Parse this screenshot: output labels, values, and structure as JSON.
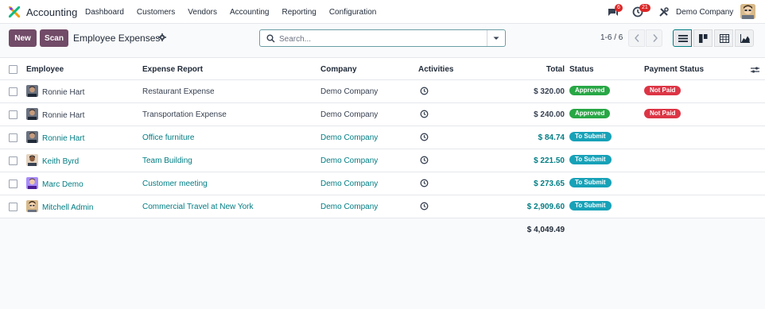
{
  "app": {
    "name": "Accounting"
  },
  "nav": {
    "items": [
      "Dashboard",
      "Customers",
      "Vendors",
      "Accounting",
      "Reporting",
      "Configuration"
    ]
  },
  "systray": {
    "messages_count": "6",
    "activities_count": "21",
    "company": "Demo Company"
  },
  "control": {
    "new_label": "New",
    "scan_label": "Scan",
    "title": "Employee Expenses",
    "search_placeholder": "Search...",
    "pager": "1-6 / 6"
  },
  "columns": {
    "employee": "Employee",
    "expense_report": "Expense Report",
    "company": "Company",
    "activities": "Activities",
    "total": "Total",
    "status": "Status",
    "payment_status": "Payment Status"
  },
  "rows": [
    {
      "employee": "Ronnie Hart",
      "report": "Restaurant Expense",
      "company": "Demo Company",
      "total": "$ 320.00",
      "status": "Approved",
      "payment": "Not Paid",
      "link": false
    },
    {
      "employee": "Ronnie Hart",
      "report": "Transportation Expense",
      "company": "Demo Company",
      "total": "$ 240.00",
      "status": "Approved",
      "payment": "Not Paid",
      "link": false
    },
    {
      "employee": "Ronnie Hart",
      "report": "Office furniture",
      "company": "Demo Company",
      "total": "$ 84.74",
      "status": "To Submit",
      "payment": "",
      "link": true
    },
    {
      "employee": "Keith Byrd",
      "report": "Team Building",
      "company": "Demo Company",
      "total": "$ 221.50",
      "status": "To Submit",
      "payment": "",
      "link": true
    },
    {
      "employee": "Marc Demo",
      "report": "Customer meeting",
      "company": "Demo Company",
      "total": "$ 273.65",
      "status": "To Submit",
      "payment": "",
      "link": true
    },
    {
      "employee": "Mitchell Admin",
      "report": "Commercial Travel at New York",
      "company": "Demo Company",
      "total": "$ 2,909.60",
      "status": "To Submit",
      "payment": "",
      "link": true
    }
  ],
  "footer": {
    "grand_total": "$ 4,049.49"
  },
  "colors": {
    "brand": "#714b67",
    "link": "#017e84",
    "approved": "#28a745",
    "to_submit": "#17a2b8",
    "not_paid": "#dc3545"
  }
}
